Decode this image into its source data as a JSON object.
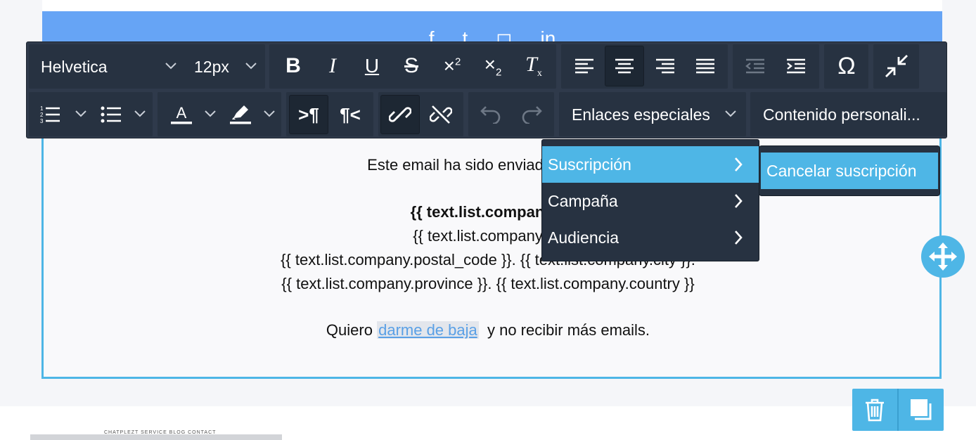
{
  "email": {
    "sent_to_line": "Este email ha sido enviado a {{ text",
    "company_name_line": "{{ text.list.company.n",
    "company_address_line": "{{ text.list.company.ad",
    "postal_line": "{{ text.list.company.postal_code }}. {{ text.list.company.city }}.",
    "province_line": "{{ text.list.company.province }}. {{ text.list.company.country }}",
    "unsubscribe_prefix": "Quiero",
    "unsubscribe_link": "darme de baja",
    "unsubscribe_suffix": "y no recibir más emails."
  },
  "toolbar": {
    "font_family": "Helvetica",
    "font_size": "12px",
    "special_links_label": "Enlaces especiales",
    "custom_content_label": "Contenido personali...",
    "active_alignment": "center"
  },
  "special_links_menu": {
    "items": [
      {
        "label": "Suscripción",
        "highlighted": true
      },
      {
        "label": "Campaña",
        "highlighted": false
      },
      {
        "label": "Audiencia",
        "highlighted": false
      }
    ]
  },
  "subscription_submenu": {
    "items": [
      {
        "label": "Cancelar suscripción"
      }
    ]
  },
  "footer": {
    "nav_text": "CHATPLEZT  SERVICE  BLOG  CONTACT"
  },
  "colors": {
    "accent": "#4eb6e6",
    "header_blue": "#66a4f5",
    "toolbar_bg": "#2f3a4b",
    "link": "#5aa0e6"
  }
}
